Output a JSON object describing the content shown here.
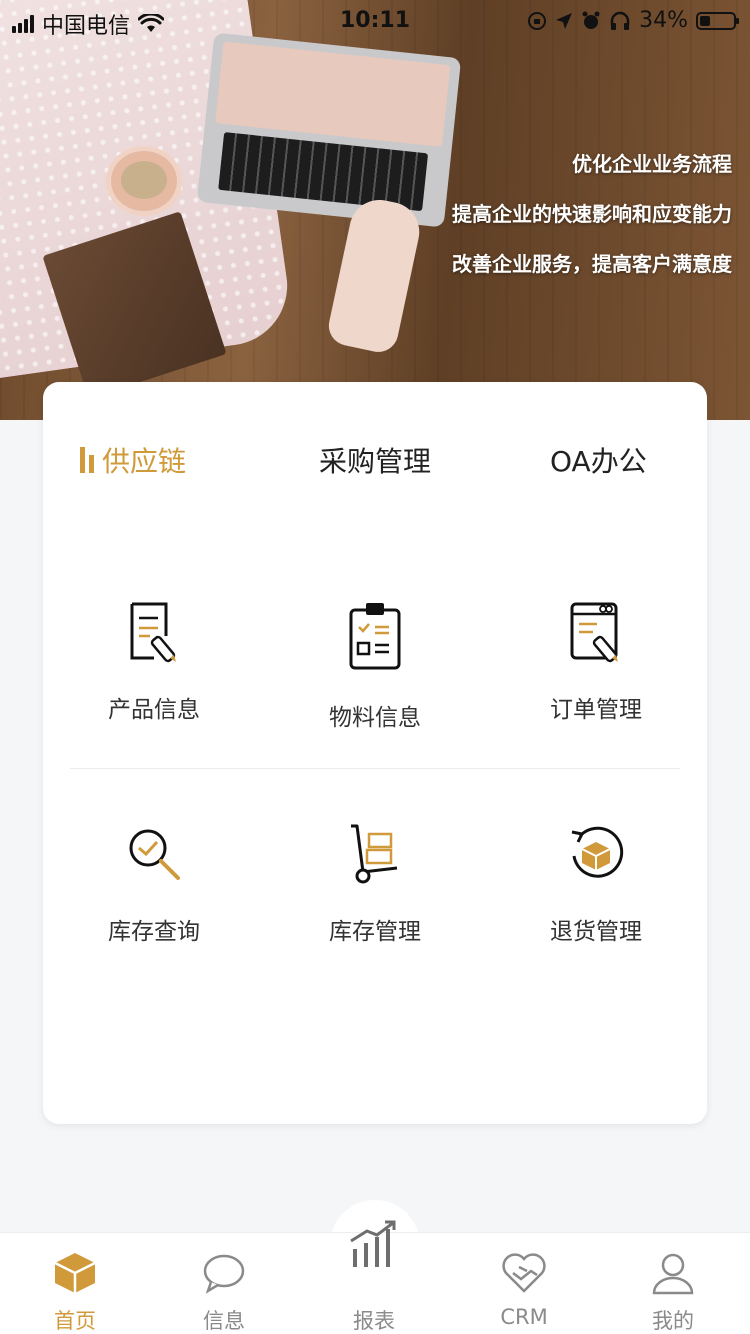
{
  "status_bar": {
    "carrier": "中国电信",
    "time": "10:11",
    "battery": "34%",
    "icons": [
      "signal-icon",
      "wifi-icon",
      "lock-rotation-icon",
      "location-icon",
      "alarm-icon",
      "headphones-icon",
      "battery-icon"
    ]
  },
  "hero": {
    "slogans": [
      "优化企业业务流程",
      "提高企业的快速影响和应变能力",
      "改善企业服务，提高客户满意度"
    ]
  },
  "tabs": [
    {
      "label": "供应链",
      "active": true
    },
    {
      "label": "采购管理",
      "active": false
    },
    {
      "label": "OA办公",
      "active": false
    }
  ],
  "modules": [
    {
      "label": "产品信息",
      "icon": "product-info-icon"
    },
    {
      "label": "物料信息",
      "icon": "material-info-icon"
    },
    {
      "label": "订单管理",
      "icon": "order-management-icon"
    },
    {
      "label": "库存查询",
      "icon": "inventory-search-icon"
    },
    {
      "label": "库存管理",
      "icon": "inventory-management-icon"
    },
    {
      "label": "退货管理",
      "icon": "return-management-icon"
    }
  ],
  "bottom_nav": [
    {
      "label": "首页",
      "icon": "home-box-icon",
      "active": true
    },
    {
      "label": "信息",
      "icon": "message-bubble-icon",
      "active": false
    },
    {
      "label": "报表",
      "icon": "report-chart-icon",
      "active": false
    },
    {
      "label": "CRM",
      "icon": "handshake-heart-icon",
      "active": false
    },
    {
      "label": "我的",
      "icon": "user-icon",
      "active": false
    }
  ],
  "colors": {
    "accent": "#d09a3b",
    "text_dark": "#222222",
    "nav_inactive": "#8a8a8a",
    "background": "#f5f6f8"
  }
}
